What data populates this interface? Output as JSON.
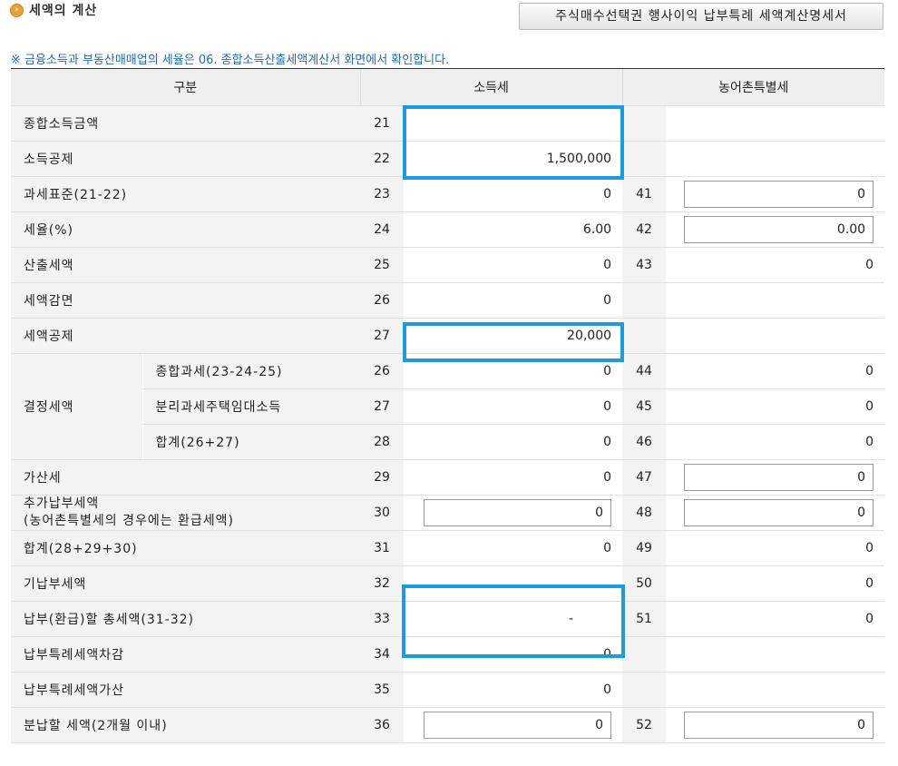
{
  "header": {
    "title": "세액의 계산",
    "detail_button": "주식매수선택권 행사이익 납부특례 세액계산명세서",
    "notice": "※ 금융소득과 부동산매매업의 세율은 06. 종합소득산출세액계산서 화면에서 확인합니다."
  },
  "columns": {
    "category": "구분",
    "income_tax": "소득세",
    "rural_tax": "농어촌특별세"
  },
  "rows": [
    {
      "label": "종합소득금액",
      "no": "21",
      "value": "",
      "rno": "",
      "rvalue": ""
    },
    {
      "label": "소득공제",
      "no": "22",
      "value": "1,500,000",
      "rno": "",
      "rvalue": ""
    },
    {
      "label": "과세표준(21-22)",
      "no": "23",
      "value": "0",
      "rno": "41",
      "rvalue": "0"
    },
    {
      "label": "세율(%)",
      "no": "24",
      "value": "6.00",
      "rno": "42",
      "rvalue": "0.00"
    },
    {
      "label": "산출세액",
      "no": "25",
      "value": "0",
      "rno": "43",
      "rvalue": "0"
    },
    {
      "label": "세액감면",
      "no": "26",
      "value": "0",
      "rno": "",
      "rvalue": ""
    },
    {
      "label": "세액공제",
      "no": "27",
      "value": "20,000",
      "rno": "",
      "rvalue": ""
    },
    {
      "group": "결정세액",
      "label": "종합과세(23-24-25)",
      "no": "26",
      "value": "0",
      "rno": "44",
      "rvalue": "0"
    },
    {
      "label": "분리과세주택임대소득",
      "no": "27",
      "value": "0",
      "rno": "45",
      "rvalue": "0"
    },
    {
      "label": "합계(26+27)",
      "no": "28",
      "value": "0",
      "rno": "46",
      "rvalue": "0"
    },
    {
      "label": "가산세",
      "no": "29",
      "value": "0",
      "rno": "47",
      "rvalue": "0"
    },
    {
      "label": "추가납부세액",
      "label2": "(농어촌특별세의 경우에는 환급세액)",
      "no": "30",
      "value": "0",
      "rno": "48",
      "rvalue": "0"
    },
    {
      "label": "합계(28+29+30)",
      "no": "31",
      "value": "0",
      "rno": "49",
      "rvalue": "0"
    },
    {
      "label": "기납부세액",
      "no": "32",
      "value": "",
      "rno": "50",
      "rvalue": "0"
    },
    {
      "label": "납부(환급)할 총세액(31-32)",
      "no": "33",
      "value": "-",
      "rno": "51",
      "rvalue": "0"
    },
    {
      "label": "납부특례세액차감",
      "no": "34",
      "value": "0",
      "rno": "",
      "rvalue": ""
    },
    {
      "label": "납부특례세액가산",
      "no": "35",
      "value": "0",
      "rno": "",
      "rvalue": ""
    },
    {
      "label": "분납할 세액(2개월 이내)",
      "no": "36",
      "value": "0",
      "rno": "52",
      "rvalue": "0"
    }
  ],
  "colors": {
    "highlight": "#1e9cd7",
    "notice": "#2a6aa8"
  }
}
